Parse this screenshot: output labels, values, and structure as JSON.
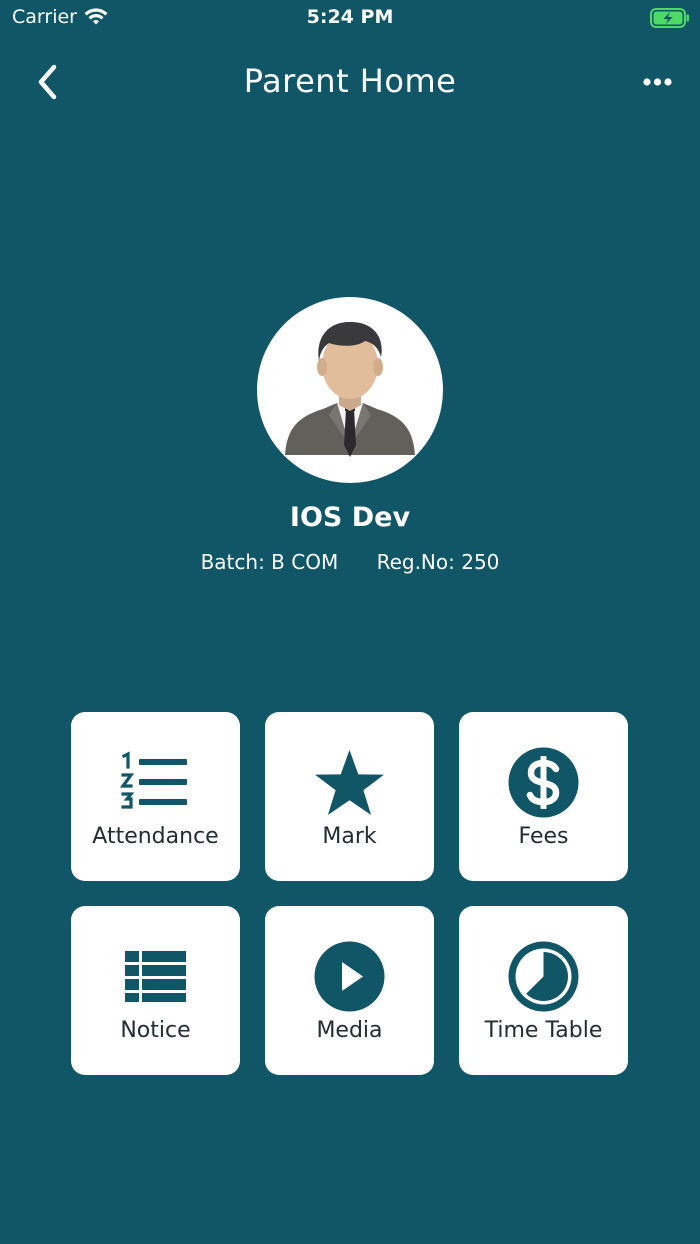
{
  "status_bar": {
    "carrier": "Carrier",
    "time": "5:24 PM",
    "wifi_icon": "wifi-icon",
    "battery_icon": "battery-charging-icon"
  },
  "nav": {
    "title": "Parent Home",
    "back_icon": "chevron-left-icon",
    "more_icon": "ellipsis-icon"
  },
  "profile": {
    "name": "IOS Dev",
    "batch": "Batch: B COM",
    "reg_no": "Reg.No: 250",
    "avatar_icon": "user-avatar"
  },
  "menu": {
    "attendance": "Attendance",
    "mark": "Mark",
    "fees": "Fees",
    "notice": "Notice",
    "media": "Media",
    "timetable": "Time Table"
  },
  "colors": {
    "background": "#105667",
    "tile_background": "#ffffff",
    "icon": "#105667",
    "battery": "#4cd964"
  }
}
